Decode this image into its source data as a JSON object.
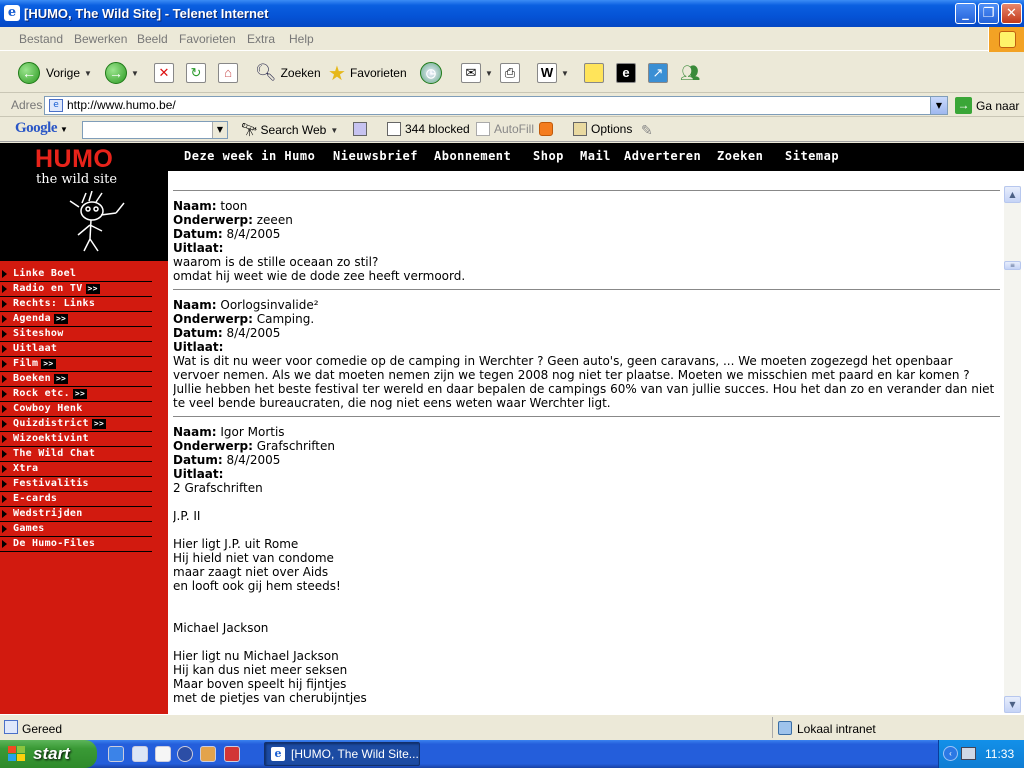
{
  "window": {
    "title": "[HUMO, The Wild Site] - Telenet Internet"
  },
  "menu": [
    "Bestand",
    "Bewerken",
    "Beeld",
    "Favorieten",
    "Extra",
    "Help"
  ],
  "toolbar": {
    "back": "Vorige",
    "search": "Zoeken",
    "favorites": "Favorieten"
  },
  "address": {
    "label": "Adres",
    "url": "http://www.humo.be/",
    "go": "Ga naar"
  },
  "google": {
    "logo": "Google",
    "search_web": "Search Web",
    "blocked": "344 blocked",
    "autofill": "AutoFill",
    "options": "Options"
  },
  "site": {
    "brand": "HUMO",
    "tagline": "the wild site",
    "topnav": [
      "Deze week in Humo",
      "Nieuwsbrief",
      "Abonnement",
      "Shop",
      "Mail",
      "Adverteren",
      "Zoeken",
      "Sitemap"
    ],
    "sidebar": [
      {
        "label": "Linke Boel",
        "arrow": ""
      },
      {
        "label": "Radio en TV",
        "arrow": ">>"
      },
      {
        "label": "Rechts: Links",
        "arrow": ""
      },
      {
        "label": "Agenda",
        "arrow": ">>"
      },
      {
        "label": "Siteshow",
        "arrow": ""
      },
      {
        "label": "Uitlaat",
        "arrow": ""
      },
      {
        "label": "Film",
        "arrow": ">>"
      },
      {
        "label": "Boeken",
        "arrow": ">>"
      },
      {
        "label": "Rock etc.",
        "arrow": ">>"
      },
      {
        "label": "Cowboy Henk",
        "arrow": ""
      },
      {
        "label": "Quizdistrict",
        "arrow": ">>"
      },
      {
        "label": "Wizoektivint",
        "arrow": ""
      },
      {
        "label": "The Wild Chat",
        "arrow": ""
      },
      {
        "label": "Xtra",
        "arrow": ""
      },
      {
        "label": "Festivalitis",
        "arrow": ""
      },
      {
        "label": "E-cards",
        "arrow": ""
      },
      {
        "label": "Wedstrijden",
        "arrow": ""
      },
      {
        "label": "Games",
        "arrow": ""
      },
      {
        "label": "De Humo-Files",
        "arrow": ""
      }
    ],
    "field_labels": {
      "name": "Naam:",
      "subject": "Onderwerp:",
      "date": "Datum:",
      "message": "Uitlaat:"
    },
    "posts": [
      {
        "name": "toon",
        "subject": "zeeen",
        "date": "8/4/2005",
        "message": "waarom is de stille oceaan zo stil?\nomdat hij weet wie de dode zee heeft vermoord."
      },
      {
        "name": "Oorlogsinvalide²",
        "subject": "Camping.",
        "date": "8/4/2005",
        "message": "Wat is dit nu weer voor comedie op de camping in Werchter ? Geen auto's, geen caravans, ... We moeten zogezegd het openbaar vervoer nemen. Als we dat moeten nemen zijn we tegen 2008 nog niet ter plaatse. Moeten we misschien met paard en kar komen ? Jullie hebben het beste festival ter wereld en daar bepalen de campings 60% van van jullie succes. Hou het dan zo en verander dan niet te veel bende bureaucraten, die nog niet eens weten waar Werchter ligt."
      },
      {
        "name": "Igor Mortis",
        "subject": "Grafschriften",
        "date": "8/4/2005",
        "message": "2 Grafschriften\n\nJ.P. II\n\nHier ligt J.P. uit Rome\nHij hield niet van condome\nmaar zaagt niet over Aids\nen looft ook gij hem steeds!\n\n\nMichael Jackson\n\nHier ligt nu Michael Jackson\nHij kan dus niet meer seksen\nMaar boven speelt hij fijntjes\nmet de pietjes van cherubijntjes"
      }
    ]
  },
  "status": {
    "text": "Gereed",
    "zone": "Lokaal intranet"
  },
  "taskbar": {
    "start": "start",
    "app": "[HUMO, The Wild Site...",
    "clock": "11:33"
  }
}
